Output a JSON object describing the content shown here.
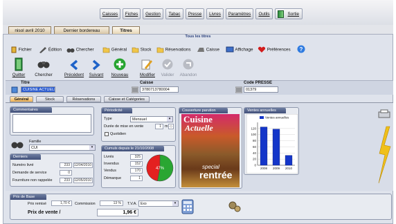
{
  "menu": {
    "items": [
      "Caisses",
      "Fiches",
      "Gestion",
      "Tabac",
      "Presse",
      "Livres",
      "Paramètres",
      "Outils",
      "Sortie"
    ]
  },
  "doc_tabs": [
    {
      "label": "nisol avril 2010"
    },
    {
      "label": "Dernier bordereau"
    },
    {
      "label": "Titres"
    }
  ],
  "panel_title": "Tous les titres",
  "toolbar1": [
    "Fichier",
    "Édition",
    "Chercher",
    "Général",
    "Stock",
    "Réservations",
    "Caisse",
    "Affichage",
    "Préférences"
  ],
  "toolbar2": [
    "Quitter",
    "Chercher",
    "Précédent",
    "Suivant",
    "Nouveau",
    "Modifier",
    "Valider",
    "Abandon"
  ],
  "fields": {
    "titre_label": "Titre",
    "titre_value": "CUISINE ACTUELLE",
    "caisse_label": "Caisse",
    "caisse_value": "3780713780004",
    "code_label": "Code PRESSE",
    "code_value": "01379"
  },
  "subtabs": [
    "Général",
    "Stock",
    "Réservations",
    "Caisse et Catégories"
  ],
  "commentaires": {
    "title": "Commentaires",
    "value": ""
  },
  "famille": {
    "label": "Famille",
    "value": "CUI"
  },
  "derniers": {
    "title": "Derniers",
    "rows": [
      {
        "label": "Numéro livré",
        "num": "233",
        "date": "12/04/2010"
      },
      {
        "label": "Demande de service",
        "num": "0",
        "date": ""
      },
      {
        "label": "Fourniture non rappelée",
        "num": "233",
        "date": "12/05/2010"
      }
    ]
  },
  "periodicite": {
    "title": "Périodicité",
    "type_label": "Type",
    "type_value": "Mensuel",
    "duree_label": "Durée de mise en vente",
    "duree_value": "1",
    "duree_unit": "m",
    "quotidien_label": "Quotidien"
  },
  "cumuls": {
    "title": "Cumuls depuis le 21/10/2008",
    "rows": [
      {
        "label": "Livrés",
        "value": "325"
      },
      {
        "label": "Invendus",
        "value": "152"
      },
      {
        "label": "Vendus",
        "value": "170"
      },
      {
        "label": "Démarque",
        "value": "1"
      }
    ],
    "pie_label": "47%"
  },
  "couverture": {
    "title": "Couverture parution",
    "mag_line1": "Cuisine",
    "mag_line2": "Actuelle",
    "mag_footer1": "special",
    "mag_footer2": "rentrée"
  },
  "ventes": {
    "title": "Ventes annuelles"
  },
  "chart_data": {
    "type": "bar",
    "categories": [
      "2008",
      "2009",
      "2010"
    ],
    "series": [
      {
        "name": "Ventes annuelles",
        "values": [
          125,
          118,
          32
        ]
      }
    ],
    "ylim": [
      0,
      140
    ],
    "yticks": [
      0,
      20,
      40,
      60,
      80,
      100,
      120
    ],
    "color": "#1436c9"
  },
  "prix": {
    "title": "Prix de Base",
    "prix_remise_label": "Prix remisé",
    "prix_remise_value": "1,70 €",
    "commission_label": "Commission",
    "commission_value": "13 %",
    "tva_label": "T.V.A.",
    "tva_value": "Exo",
    "vente_label": "Prix de vente /",
    "vente_value": "1,96 €"
  },
  "colors": {
    "accent_orange": "#f0b150",
    "header_blue": "#41507a",
    "bar_blue": "#1436c9"
  }
}
